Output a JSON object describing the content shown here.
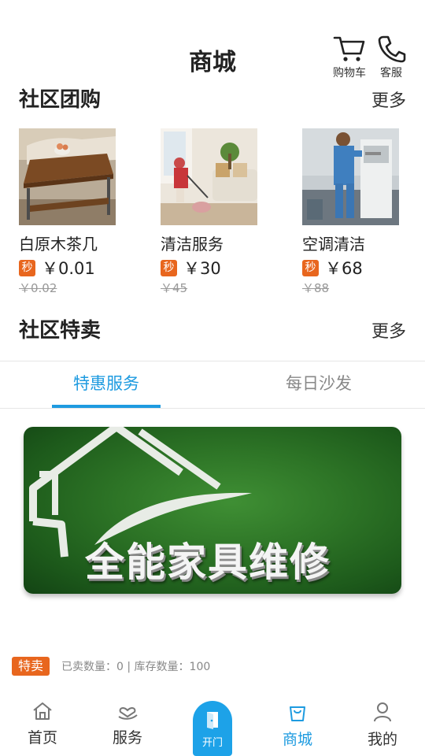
{
  "header": {
    "title": "商城",
    "cart_label": "购物车",
    "service_label": "客服"
  },
  "group_buy": {
    "title": "社区团购",
    "more": "更多",
    "items": [
      {
        "name": "白原木茶几",
        "badge": "秒",
        "price": "￥0.01",
        "original_price": "￥0.02",
        "image": "wooden-coffee-table"
      },
      {
        "name": "清洁服务",
        "badge": "秒",
        "price": "￥30",
        "original_price": "￥45",
        "image": "vacuum-cleaning"
      },
      {
        "name": "空调清洁",
        "badge": "秒",
        "price": "￥68",
        "original_price": "￥88",
        "image": "air-conditioner-cleaning"
      }
    ]
  },
  "special_sale": {
    "title": "社区特卖",
    "more": "更多",
    "tabs": [
      {
        "label": "特惠服务",
        "active": true
      },
      {
        "label": "每日沙发",
        "active": false
      }
    ],
    "banner_text": "全能家具维修",
    "badge": "特卖",
    "stock_info": "已卖数量：0 | 库存数量：100"
  },
  "bottom_nav": {
    "items": [
      {
        "label": "首页",
        "icon": "home-icon",
        "active": false
      },
      {
        "label": "服务",
        "icon": "heart-hand-icon",
        "active": false
      },
      {
        "label": "开门",
        "icon": "door-icon",
        "active": false
      },
      {
        "label": "商城",
        "icon": "shopping-bag-icon",
        "active": true
      },
      {
        "label": "我的",
        "icon": "person-icon",
        "active": false
      }
    ]
  },
  "colors": {
    "accent": "#1e9be0",
    "badge": "#e8661e",
    "banner_green": "#2d7426"
  }
}
